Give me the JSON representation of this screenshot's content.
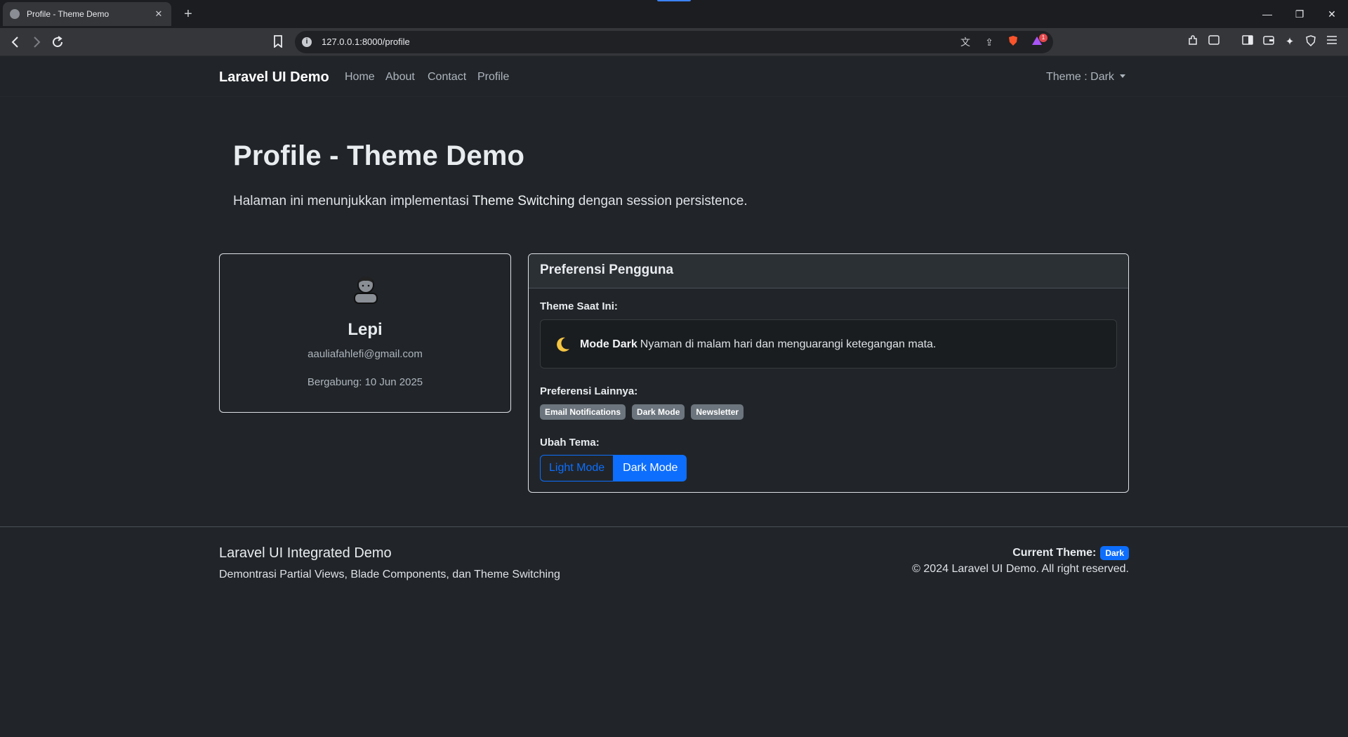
{
  "browser": {
    "tab_title": "Profile - Theme Demo",
    "tab_close": "✕",
    "new_tab": "+",
    "url": "127.0.0.1:8000/profile",
    "notification_count": "1",
    "window_controls": {
      "minimize": "—",
      "restore": "❐",
      "close": "✕"
    },
    "icons": {
      "back": "back-arrow-icon",
      "forward": "forward-arrow-icon",
      "reload": "reload-icon",
      "bookmark": "bookmark-icon",
      "site_info": "site-info-icon",
      "translate": "translate-icon",
      "share": "share-icon",
      "shields": "brave-shields-icon",
      "rewards": "brave-rewards-icon",
      "extensions": "extensions-icon",
      "tab_search": "tab-search-icon",
      "sidebar": "sidebar-icon",
      "wallet": "wallet-icon",
      "leo": "leo-ai-icon",
      "vpn": "vpn-icon",
      "menu": "menu-icon"
    }
  },
  "navbar": {
    "brand": "Laravel UI Demo",
    "links": [
      "Home",
      "About",
      "Contact",
      "Profile"
    ],
    "theme_dropdown": "Theme : Dark"
  },
  "hero": {
    "title": "Profile - Theme Demo",
    "lead_prefix": "Halaman ini menunjukkan implementasi ",
    "lead_bold": "Theme Switching",
    "lead_suffix": " dengan session persistence."
  },
  "profile": {
    "avatar_icon": "person-avatar-icon",
    "name": "Lepi",
    "email": "aauliafahlefi@gmail.com",
    "joined": "Bergabung: 10 Jun 2025"
  },
  "preferences": {
    "header": "Preferensi Pengguna",
    "current_label": "Theme Saat Ini:",
    "current_icon": "crescent-moon-icon",
    "current_mode": "Mode Dark",
    "current_desc": "Nyaman di malam hari dan menguarangi ketegangan mata.",
    "other_label": "Preferensi Lainnya:",
    "badges": [
      "Email Notifications",
      "Dark Mode",
      "Newsletter"
    ],
    "change_label": "Ubah Tema:",
    "light_button": "Light Mode",
    "dark_button": "Dark Mode",
    "active_theme": "Dark Mode"
  },
  "footer": {
    "title": "Laravel UI Integrated Demo",
    "desc": "Demontrasi Partial Views, Blade Components, dan Theme Switching",
    "current_theme_label": "Current Theme:",
    "current_theme_value": "Dark",
    "copyright": "© 2024 Laravel UI Demo. All right reserved."
  },
  "colors": {
    "page_bg": "#212529",
    "primary": "#0d6efd",
    "badge_secondary": "#6c757d",
    "chrome_bg": "#35363a"
  }
}
